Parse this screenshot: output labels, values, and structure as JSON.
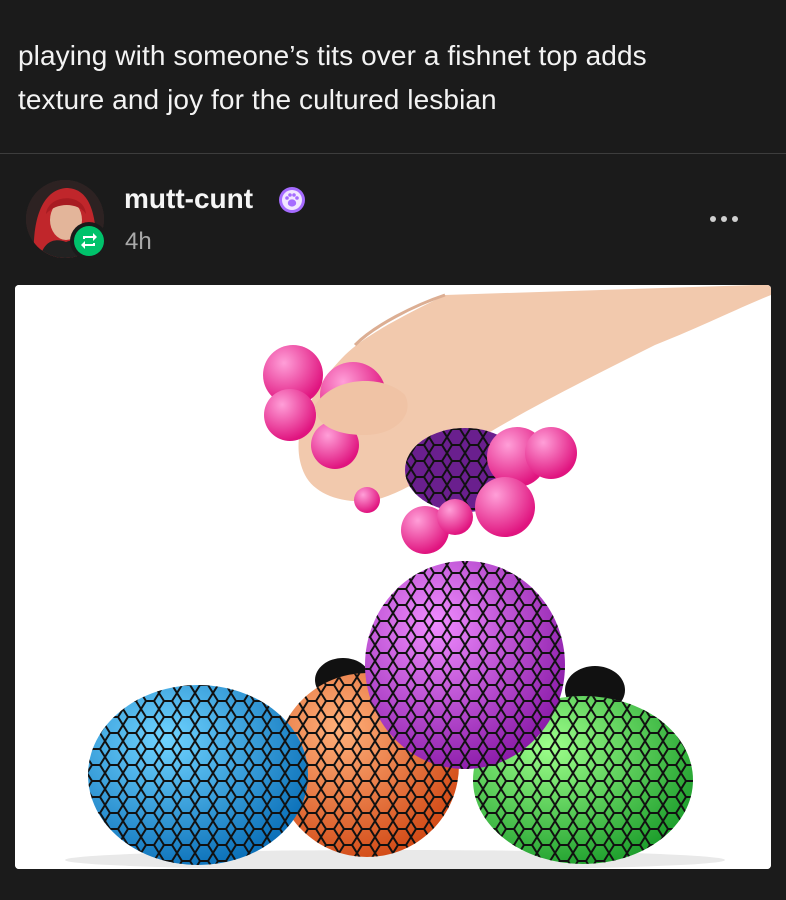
{
  "post": {
    "text_line1": "playing with someone’s tits over a fishnet top adds",
    "text_line2": "texture and joy for the cultured lesbian"
  },
  "author": {
    "username": "mutt-cunt",
    "timestamp": "4h",
    "badge_icon": "paw-badge-icon",
    "reblog_icon": "reblog-icon"
  },
  "colors": {
    "background": "#1b1b1b",
    "reblog_green": "#00c26b",
    "badge_purple": "#a56bff"
  },
  "image": {
    "subject": "stress balls"
  }
}
